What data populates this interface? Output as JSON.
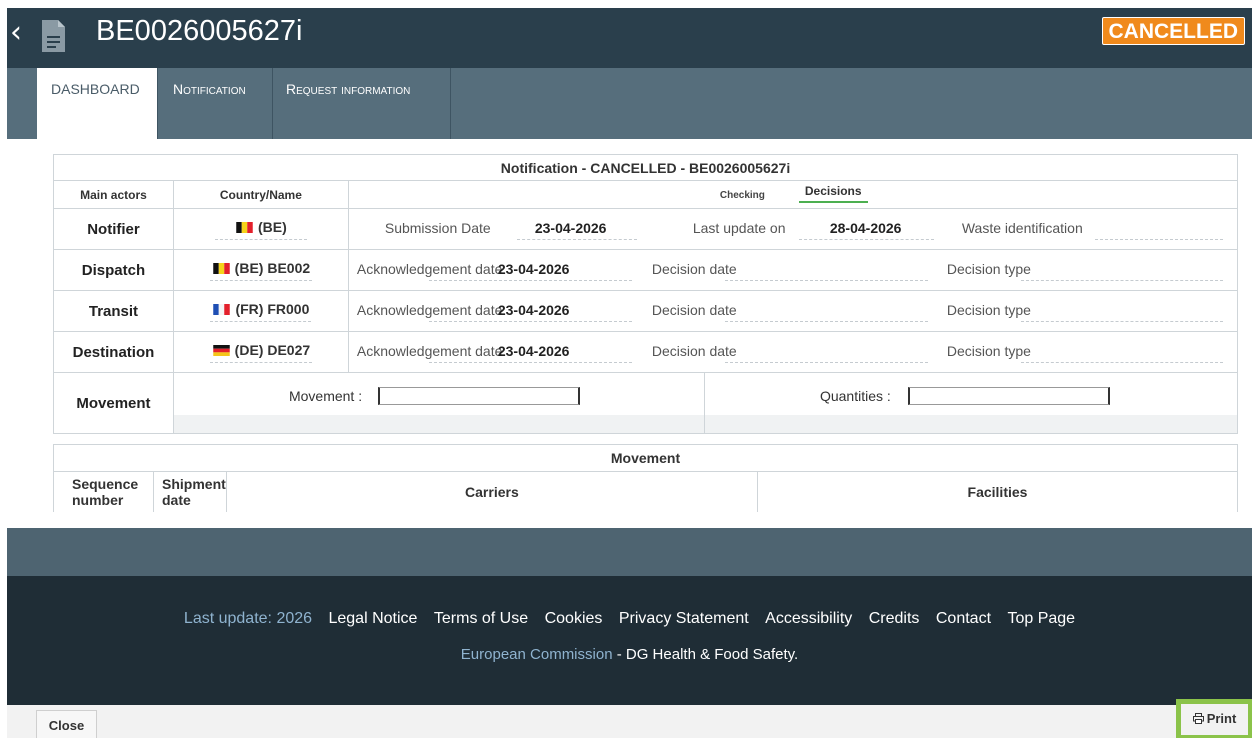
{
  "header": {
    "back_glyph": "‹",
    "title": "BE0026005627i",
    "status_badge": "CANCELLED",
    "doc_icon": "document-icon"
  },
  "tabs": [
    {
      "label": "DASHBOARD",
      "active": true
    },
    {
      "label": "Notification",
      "active": false
    },
    {
      "label": "Request information",
      "active": false
    }
  ],
  "notification_table": {
    "caption": "Notification - CANCELLED - BE0026005627i",
    "col_main_actors": "Main actors",
    "col_country": "Country/Name",
    "tab_checking": "Checking",
    "tab_decisions": "Decisions",
    "notifier": {
      "label": "Notifier",
      "country": "(BE)",
      "submission_label": "Submission Date",
      "submission_value": "23-04-2026",
      "last_update_label": "Last update on",
      "last_update_value": "28-04-2026",
      "waste_label": "Waste identification"
    },
    "dispatch": {
      "label": "Dispatch",
      "country": "(BE) BE002",
      "ack_label": "Acknowledgement date",
      "ack_value": "23-04-2026",
      "decision_date_label": "Decision date",
      "decision_type_label": "Decision type"
    },
    "transit": {
      "label": "Transit",
      "country": "(FR) FR000",
      "ack_label": "Acknowledgement date",
      "ack_value": "23-04-2026",
      "decision_date_label": "Decision date",
      "decision_type_label": "Decision type"
    },
    "destination": {
      "label": "Destination",
      "country": "(DE) DE027",
      "ack_label": "Acknowledgement date",
      "ack_value": "23-04-2026",
      "decision_date_label": "Decision date",
      "decision_type_label": "Decision type"
    },
    "movement": {
      "label": "Movement",
      "movement_field_label": "Movement :",
      "movement_value": "",
      "quantities_field_label": "Quantities :",
      "quantities_value": ""
    }
  },
  "movement_table": {
    "caption": "Movement",
    "col_sequence": "Sequence number",
    "col_shipment": "Shipment date",
    "col_carriers": "Carriers",
    "col_facilities": "Facilities"
  },
  "footer": {
    "last_update": "Last update: 2026",
    "links": [
      "Legal Notice",
      "Terms of Use",
      "Cookies",
      "Privacy Statement",
      "Accessibility",
      "Credits",
      "Contact",
      "Top Page"
    ],
    "ec_link": "European Commission",
    "ec_sep": " - ",
    "dg": "DG Health & Food Safety."
  },
  "actions": {
    "close_label": "Close",
    "print_label": "Print",
    "print_icon": "printer-icon"
  },
  "colors": {
    "header": "#2a3f4c",
    "tabs_band": "#566e7c",
    "badge": "#f08a1c",
    "footer": "#1f2d36",
    "print_highlight": "#8bc34a",
    "decisions_underline": "#4caf50"
  }
}
